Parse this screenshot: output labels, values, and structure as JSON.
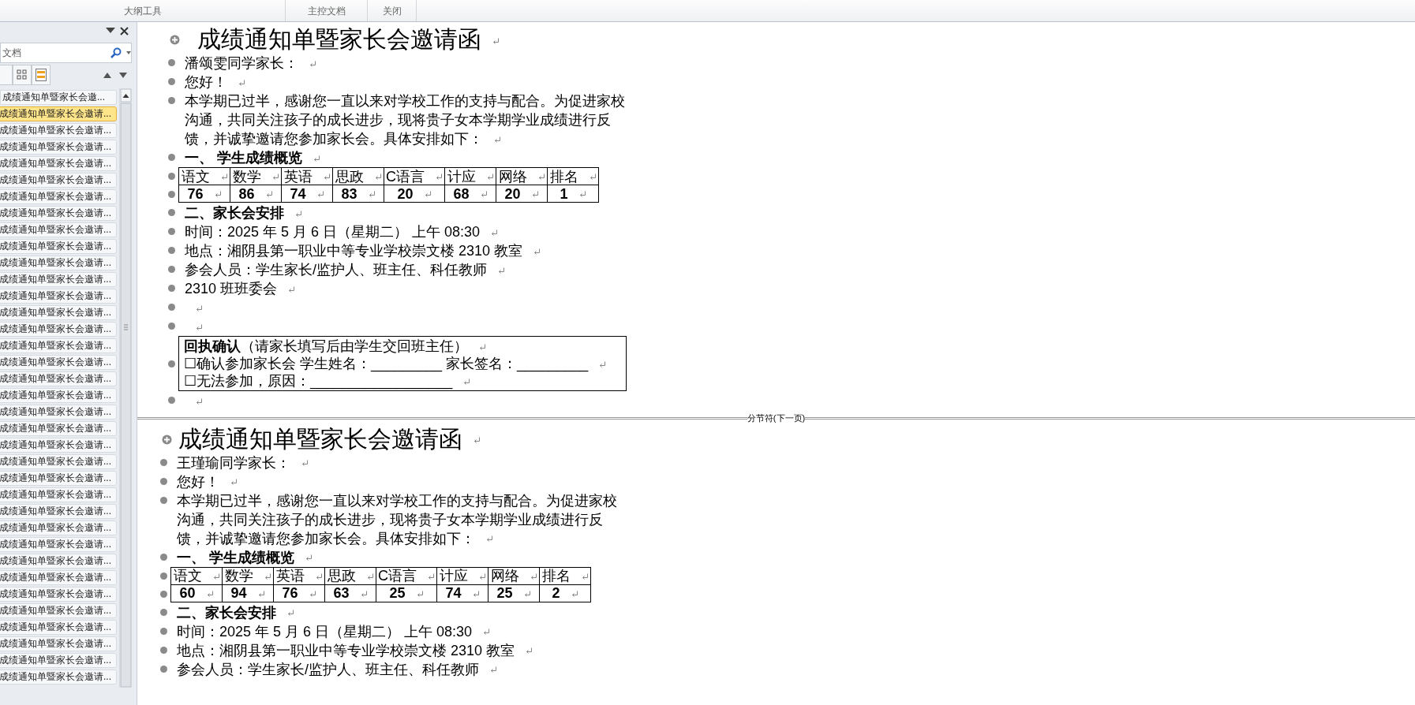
{
  "ribbon": {
    "tabs": [
      {
        "label": "大纲工具"
      },
      {
        "label": "主控文档"
      },
      {
        "label": "关闭"
      }
    ]
  },
  "navigation_pane": {
    "search": {
      "value": "文档"
    },
    "items": [
      {
        "label": "成绩通知单暨家长会邀...",
        "selected": false
      },
      {
        "label": "成绩通知单暨家长会邀请...",
        "selected": true
      },
      {
        "label": "成绩通知单暨家长会邀请...",
        "selected": false
      },
      {
        "label": "成绩通知单暨家长会邀请...",
        "selected": false
      },
      {
        "label": "成绩通知单暨家长会邀请...",
        "selected": false
      },
      {
        "label": "成绩通知单暨家长会邀请...",
        "selected": false
      },
      {
        "label": "成绩通知单暨家长会邀请...",
        "selected": false
      },
      {
        "label": "成绩通知单暨家长会邀请...",
        "selected": false
      },
      {
        "label": "成绩通知单暨家长会邀请...",
        "selected": false
      },
      {
        "label": "成绩通知单暨家长会邀请...",
        "selected": false
      },
      {
        "label": "成绩通知单暨家长会邀请...",
        "selected": false
      },
      {
        "label": "成绩通知单暨家长会邀请...",
        "selected": false
      },
      {
        "label": "成绩通知单暨家长会邀请...",
        "selected": false
      },
      {
        "label": "成绩通知单暨家长会邀请...",
        "selected": false
      },
      {
        "label": "成绩通知单暨家长会邀请...",
        "selected": false
      },
      {
        "label": "成绩通知单暨家长会邀请...",
        "selected": false
      },
      {
        "label": "成绩通知单暨家长会邀请...",
        "selected": false
      },
      {
        "label": "成绩通知单暨家长会邀请...",
        "selected": false
      },
      {
        "label": "成绩通知单暨家长会邀请...",
        "selected": false
      },
      {
        "label": "成绩通知单暨家长会邀请...",
        "selected": false
      },
      {
        "label": "成绩通知单暨家长会邀请...",
        "selected": false
      },
      {
        "label": "成绩通知单暨家长会邀请...",
        "selected": false
      },
      {
        "label": "成绩通知单暨家长会邀请...",
        "selected": false
      },
      {
        "label": "成绩通知单暨家长会邀请...",
        "selected": false
      },
      {
        "label": "成绩通知单暨家长会邀请...",
        "selected": false
      },
      {
        "label": "成绩通知单暨家长会邀请...",
        "selected": false
      },
      {
        "label": "成绩通知单暨家长会邀请...",
        "selected": false
      },
      {
        "label": "成绩通知单暨家长会邀请...",
        "selected": false
      },
      {
        "label": "成绩通知单暨家长会邀请...",
        "selected": false
      },
      {
        "label": "成绩通知单暨家长会邀请...",
        "selected": false
      },
      {
        "label": "成绩通知单暨家长会邀请...",
        "selected": false
      },
      {
        "label": "成绩通知单暨家长会邀请...",
        "selected": false
      },
      {
        "label": "成绩通知单暨家长会邀请...",
        "selected": false
      },
      {
        "label": "成绩通知单暨家长会邀请...",
        "selected": false
      },
      {
        "label": "成绩通知单暨家长会邀请...",
        "selected": false
      },
      {
        "label": "成绩通知单暨家长会邀请...",
        "selected": false
      }
    ]
  },
  "document": {
    "sections": [
      {
        "break_label": "分节符(下一页)",
        "paragraphs": [
          {
            "kind": "title",
            "text": "成绩通知单暨家长会邀请函"
          },
          {
            "kind": "text",
            "text": "潘颂雯同学家长："
          },
          {
            "kind": "text",
            "text": "您好！"
          },
          {
            "kind": "text",
            "text": "本学期已过半，感谢您一直以来对学校工作的支持与配合。为促进家校沟通，共同关注孩子的成长进步，现将贵子女本学期学业成绩进行反馈，并诚挚邀请您参加家长会。具体安排如下："
          },
          {
            "kind": "heading",
            "text": "一、 学生成绩概览"
          },
          {
            "kind": "table",
            "header": [
              "语文",
              "数学",
              "英语",
              "思政",
              "C语言",
              "计应",
              "网络",
              "排名"
            ],
            "values": [
              "76",
              "86",
              "74",
              "83",
              "20",
              "68",
              "20",
              "1"
            ]
          },
          {
            "kind": "heading",
            "text": "二、家长会安排"
          },
          {
            "kind": "text",
            "text": "时间：2025 年 5 月 6 日（星期二） 上午 08:30"
          },
          {
            "kind": "text",
            "text": "地点：湘阴县第一职业中等专业学校崇文楼 2310 教室"
          },
          {
            "kind": "text",
            "text": "参会人员：学生家长/监护人、班主任、科任教师"
          },
          {
            "kind": "text",
            "text": "2310 班班委会"
          },
          {
            "kind": "empty"
          },
          {
            "kind": "empty"
          },
          {
            "kind": "reply_box",
            "lines": [
              "**回执确认**（请家长填写后由学生交回班主任）",
              "☐确认参加家长会  学生姓名：_________  家长签名：_________",
              "☐无法参加，原因：__________________"
            ]
          },
          {
            "kind": "empty"
          }
        ]
      },
      {
        "paragraphs": [
          {
            "kind": "title",
            "text": "成绩通知单暨家长会邀请函"
          },
          {
            "kind": "text",
            "text": "王瑾瑜同学家长："
          },
          {
            "kind": "text",
            "text": "您好！"
          },
          {
            "kind": "text",
            "text": "本学期已过半，感谢您一直以来对学校工作的支持与配合。为促进家校沟通，共同关注孩子的成长进步，现将贵子女本学期学业成绩进行反馈，并诚挚邀请您参加家长会。具体安排如下："
          },
          {
            "kind": "heading",
            "text": "一、 学生成绩概览"
          },
          {
            "kind": "table",
            "header": [
              "语文",
              "数学",
              "英语",
              "思政",
              "C语言",
              "计应",
              "网络",
              "排名"
            ],
            "values": [
              "60",
              "94",
              "76",
              "63",
              "25",
              "74",
              "25",
              "2"
            ]
          },
          {
            "kind": "heading",
            "text": "二、家长会安排"
          },
          {
            "kind": "text",
            "text": "时间：2025 年 5 月 6 日（星期二） 上午 08:30"
          },
          {
            "kind": "text",
            "text": "地点：湘阴县第一职业中等专业学校崇文楼 2310 教室"
          },
          {
            "kind": "text",
            "text": "参会人员：学生家长/监护人、班主任、科任教师"
          }
        ]
      }
    ]
  }
}
